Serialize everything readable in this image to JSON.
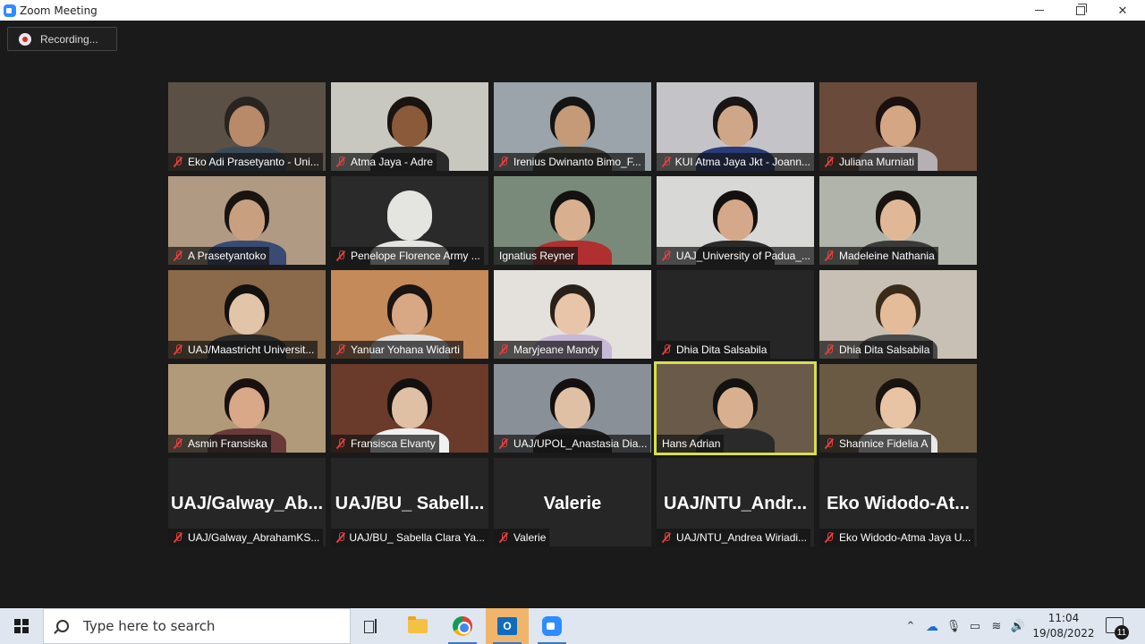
{
  "window": {
    "title": "Zoom Meeting"
  },
  "recording": {
    "label": "Recording..."
  },
  "participants": [
    {
      "name": "Eko Adi Prasetyanto - Uni...",
      "muted": true,
      "bg": "#5a5046",
      "skin": "#b88a6a",
      "hair": "#2a2420",
      "shirt": "#3a4a5a"
    },
    {
      "name": "Atma Jaya - Adre",
      "muted": true,
      "bg": "#c8c8c0",
      "skin": "#8a5a3a",
      "hair": "#1a1410",
      "shirt": "#2a2a2a"
    },
    {
      "name": "Irenius Dwinanto  Bimo_F...",
      "muted": true,
      "bg": "#9aa4aa",
      "skin": "#c49a78",
      "hair": "#141414",
      "shirt": "#3a3a32"
    },
    {
      "name": "KUI Atma Jaya Jkt - Joann...",
      "muted": true,
      "bg": "#c4c4c8",
      "skin": "#d0a688",
      "hair": "#1a1414",
      "shirt": "#2a3a7a"
    },
    {
      "name": "Juliana Murniati",
      "muted": true,
      "bg": "#6a4a3a",
      "skin": "#d4a684",
      "hair": "#1a1010",
      "shirt": "#b6b0b4"
    },
    {
      "name": "A Prasetyantoko",
      "muted": true,
      "bg": "#b09a84",
      "skin": "#c8a080",
      "hair": "#1a1410",
      "shirt": "#3a4a72"
    },
    {
      "name": "Penelope Florence Army ...",
      "muted": true,
      "bg": "#2a2a2a",
      "skin": "#e4e4e0",
      "hair": "#e4e4e0",
      "shirt": "#e4e4e0"
    },
    {
      "name": "Ignatius Reyner",
      "muted": false,
      "bg": "#7a8a7a",
      "skin": "#d8b090",
      "hair": "#141210",
      "shirt": "#b03030"
    },
    {
      "name": "UAJ_University of Padua_...",
      "muted": true,
      "bg": "#d8d8d6",
      "skin": "#d4a888",
      "hair": "#141010",
      "shirt": "#2a2a2a"
    },
    {
      "name": "Madeleine Nathania",
      "muted": true,
      "bg": "#b0b4aa",
      "skin": "#e0b898",
      "hair": "#1a1410",
      "shirt": "#3a3a3a"
    },
    {
      "name": "UAJ/Maastricht Universit...",
      "muted": true,
      "bg": "#8a6a4a",
      "skin": "#e2c4a8",
      "hair": "#141010",
      "shirt": "#2a2a2a"
    },
    {
      "name": "Yanuar Yohana Widarti",
      "muted": true,
      "bg": "#c48a5a",
      "skin": "#d8a884",
      "hair": "#1a1412",
      "shirt": "#e0e0e0"
    },
    {
      "name": "Maryjeane Mandy",
      "muted": true,
      "bg": "#e4e0dc",
      "skin": "#e8c4a8",
      "hair": "#2a201a",
      "shirt": "#c8b8d8"
    },
    {
      "name": "Dhia Dita Salsabila",
      "muted": true,
      "bg": "#262626",
      "skin": "",
      "hair": "",
      "shirt": ""
    },
    {
      "name": "Dhia Dita Salsabila",
      "muted": true,
      "bg": "#c8c0b4",
      "skin": "#e4bc9a",
      "hair": "#3a2a1a",
      "shirt": "#4a4a4a"
    },
    {
      "name": "Asmin Fransiska",
      "muted": true,
      "bg": "#b09a7a",
      "skin": "#d8a888",
      "hair": "#1a1010",
      "shirt": "#6a3a3a"
    },
    {
      "name": "Fransisca Elvanty",
      "muted": true,
      "bg": "#6a3a2a",
      "skin": "#e0c0a4",
      "hair": "#141010",
      "shirt": "#f0f0f0"
    },
    {
      "name": "UAJ/UPOL_Anastasia Dia...",
      "muted": true,
      "bg": "#8a9098",
      "skin": "#e0c0a4",
      "hair": "#141010",
      "shirt": "#1a1a1a"
    },
    {
      "name": "Hans Adrian",
      "muted": false,
      "bg": "#6a5a4a",
      "skin": "#d8b090",
      "hair": "#141210",
      "shirt": "#2a2a2a",
      "active": true
    },
    {
      "name": "Shannice Fidelia A",
      "muted": true,
      "bg": "#6a5a44",
      "skin": "#e8c4a4",
      "hair": "#1a1410",
      "shirt": "#e8e8e8"
    },
    {
      "name": "UAJ/Galway_AbrahamKS...",
      "muted": true,
      "big_name": "UAJ/Galway_Ab...",
      "no_video": true
    },
    {
      "name": "UAJ/BU_ Sabella Clara Ya...",
      "muted": true,
      "big_name": "UAJ/BU_  Sabell...",
      "no_video": true
    },
    {
      "name": "Valerie",
      "muted": true,
      "big_name": "Valerie",
      "no_video": true
    },
    {
      "name": "UAJ/NTU_Andrea Wiriadi...",
      "muted": true,
      "big_name": "UAJ/NTU_Andr...",
      "no_video": true
    },
    {
      "name": "Eko Widodo-Atma Jaya U...",
      "muted": true,
      "big_name": "Eko  Widodo-At...",
      "no_video": true
    }
  ],
  "taskbar": {
    "search_placeholder": "Type here to search",
    "time": "11:04",
    "date": "19/08/2022",
    "notification_count": "11"
  }
}
